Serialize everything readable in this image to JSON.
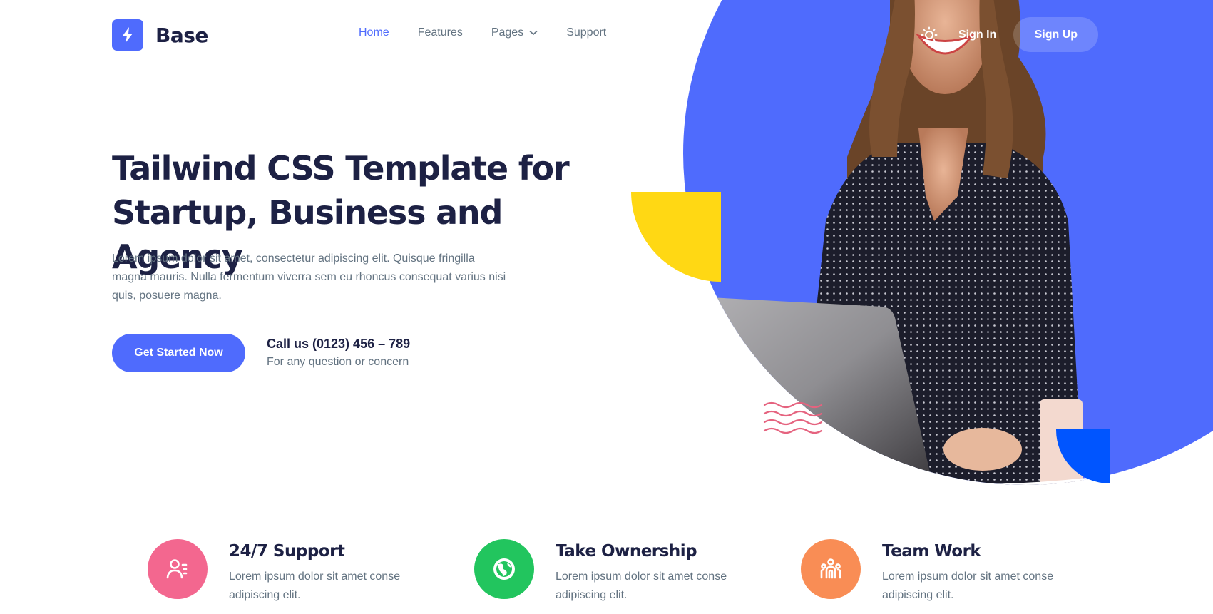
{
  "brand": {
    "name": "Base",
    "logo_icon": "lightning-bolt-icon"
  },
  "nav": {
    "items": [
      {
        "label": "Home",
        "active": true
      },
      {
        "label": "Features",
        "active": false
      },
      {
        "label": "Pages",
        "active": false,
        "has_dropdown": true
      },
      {
        "label": "Support",
        "active": false
      }
    ]
  },
  "header_actions": {
    "theme_toggle_icon": "sun-icon",
    "sign_in": "Sign In",
    "sign_up": "Sign Up"
  },
  "hero": {
    "title": "Tailwind CSS Template for Startup, Business and Agency",
    "description": "Lorem ipsum dolor sit amet, consectetur adipiscing elit. Quisque fringilla magna mauris. Nulla fermentum viverra sem eu rhoncus consequat varius nisi quis, posuere magna.",
    "cta_label": "Get Started Now",
    "call_title": "Call us (0123) 456 – 789",
    "call_subtitle": "For any question or concern",
    "image_alt": "Smiling woman working on a laptop"
  },
  "features": [
    {
      "title": "24/7 Support",
      "description": "Lorem ipsum dolor sit amet conse adipiscing elit.",
      "icon": "user-support-icon",
      "color": "#f3678f"
    },
    {
      "title": "Take Ownership",
      "description": "Lorem ipsum dolor sit amet conse adipiscing elit.",
      "icon": "globe-icon",
      "color": "#22c55e"
    },
    {
      "title": "Team Work",
      "description": "Lorem ipsum dolor sit amet conse adipiscing elit.",
      "icon": "team-icon",
      "color": "#f98d55"
    }
  ],
  "colors": {
    "primary": "#4f6bfd",
    "heading": "#1d2144",
    "body_text": "#637381",
    "accent_yellow": "#ffd814",
    "accent_blue": "#0055ff",
    "accent_pink": "#e5637f"
  }
}
